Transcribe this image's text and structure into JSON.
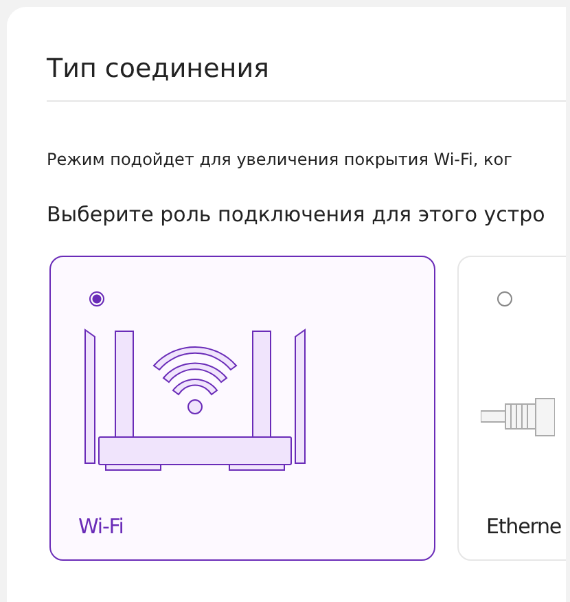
{
  "panel": {
    "title": "Тип соединения",
    "description": "Режим подойдет для увеличения покрытия Wi-Fi, ког",
    "question": "Выберите роль подключения для этого устро",
    "options": [
      {
        "kind": "wifi",
        "label": "Wi-Fi",
        "selected": true
      },
      {
        "kind": "ethernet",
        "label": "Etherne",
        "selected": false
      }
    ]
  }
}
